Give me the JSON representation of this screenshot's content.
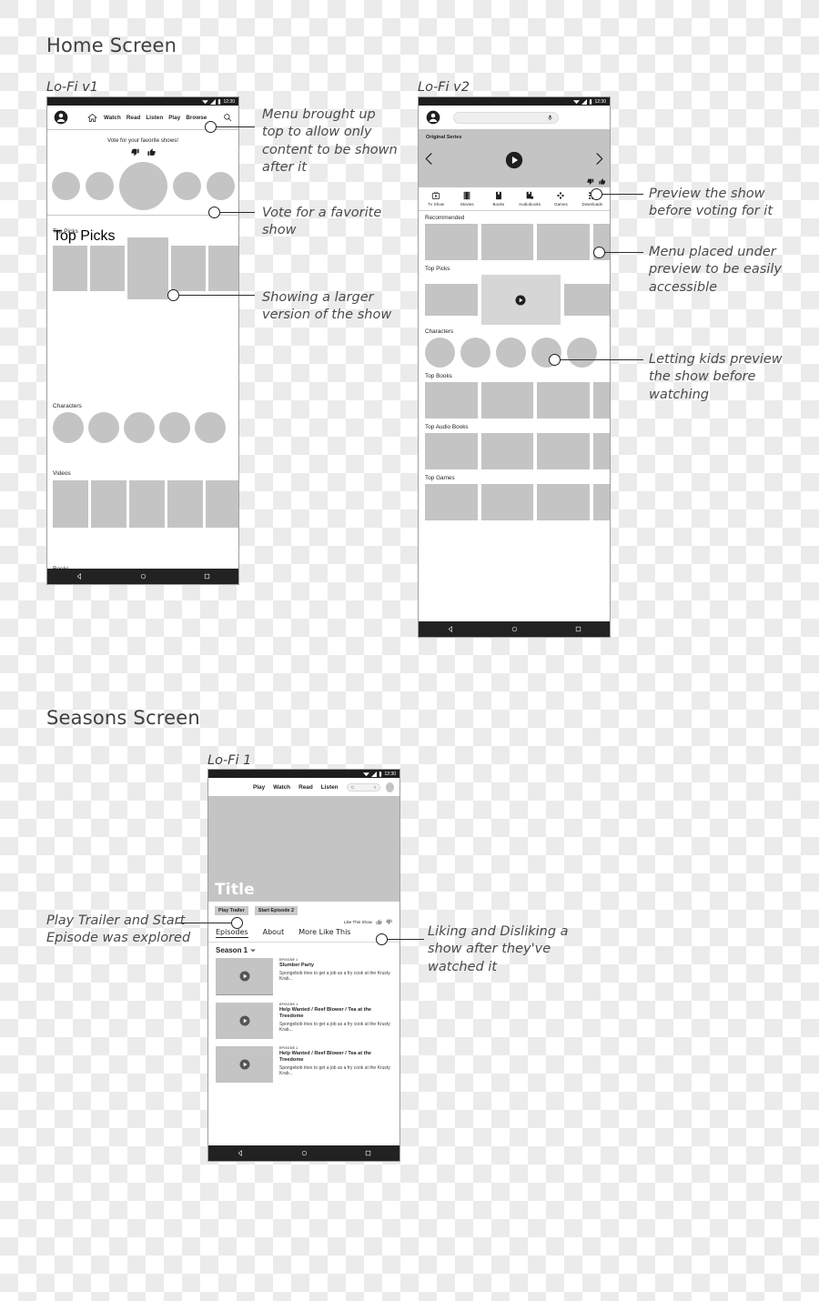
{
  "sections": {
    "home": {
      "title": "Home Screen",
      "v1_label": "Lo-Fi v1",
      "v2_label": "Lo-Fi v2"
    },
    "seasons": {
      "title": "Seasons Screen",
      "v1_label": "Lo-Fi 1"
    }
  },
  "annotations": {
    "home_v1": [
      "Menu brought up top to allow only content to be shown after it",
      "Vote for a favorite show",
      "Showing a larger version of the show"
    ],
    "home_v2": [
      "Preview the show before voting for it",
      "Menu placed under preview to be easily accessible",
      "Letting kids preview the show before watching"
    ],
    "seasons": [
      "Play Trailer and Start Episode was explored",
      "Liking and Disliking a show after they've watched it"
    ]
  },
  "phone1": {
    "status_time": "12:30",
    "nav_links": [
      "Watch",
      "Read",
      "Listen",
      "Play",
      "Browse"
    ],
    "home_icon": "home-icon",
    "avatar_icon": "account-circle-icon",
    "search_icon": "search-icon",
    "vote_prompt": "Vote for your favorite shows!",
    "thumb_down_icon": "thumb-down-icon",
    "thumb_up_icon": "thumb-up-icon",
    "rows": [
      {
        "title": "Top Picks",
        "kind": "cards-featured"
      },
      {
        "title": "Characters",
        "kind": "circles"
      },
      {
        "title": "Videos",
        "kind": "cards"
      },
      {
        "title": "Books",
        "kind": "cards-featured"
      }
    ],
    "bottom_nav": [
      "back-icon",
      "home-circle-icon",
      "recents-square-icon"
    ]
  },
  "phone2": {
    "status_time": "12:30",
    "avatar_icon": "account-circle-icon",
    "search_placeholder": "",
    "mic_icon": "microphone-icon",
    "hero_label": "Original Series",
    "prev_icon": "chevron-left-icon",
    "next_icon": "chevron-right-icon",
    "play_icon": "play-circle-icon",
    "thumb_down_icon": "thumb-down-icon",
    "thumb_up_icon": "thumb-up-icon",
    "categories": [
      {
        "label": "Tv Show",
        "icon": "tv-show-icon"
      },
      {
        "label": "Movies",
        "icon": "film-strip-icon"
      },
      {
        "label": "Books",
        "icon": "book-icon"
      },
      {
        "label": "Audiobooks",
        "icon": "audiobook-icon"
      },
      {
        "label": "Games",
        "icon": "gamepad-icon"
      },
      {
        "label": "Downloads",
        "icon": "apps-grid-icon"
      }
    ],
    "rows": [
      {
        "title": "Recommended",
        "kind": "wide-cards"
      },
      {
        "title": "Top Picks",
        "kind": "wide-cards-preview"
      },
      {
        "title": "Characters",
        "kind": "circles"
      },
      {
        "title": "Top Books",
        "kind": "wide-cards"
      },
      {
        "title": "Top Audio Books",
        "kind": "wide-cards"
      },
      {
        "title": "Top Games",
        "kind": "wide-cards"
      }
    ],
    "bottom_nav": [
      "back-icon",
      "home-circle-icon",
      "recents-square-icon"
    ]
  },
  "phone3": {
    "status_time": "12:30",
    "nav_links": [
      "Play",
      "Watch",
      "Read",
      "Listen"
    ],
    "search_icon": "search-icon",
    "mic_icon": "microphone-icon",
    "avatar_icon": "avatar-circle-icon",
    "hero_title": "Title",
    "buttons": [
      "Play Trailer",
      "Start Episode 2"
    ],
    "like_label": "Like This Show",
    "thumb_up_icon": "thumb-up-icon",
    "thumb_down_icon": "thumb-down-icon",
    "tabs": [
      "Episodes",
      "About",
      "More Like This"
    ],
    "active_tab": "Episodes",
    "season_selector": "Season 1",
    "season_caret_icon": "caret-down-icon",
    "episodes": [
      {
        "number": "EPISODE 1",
        "title": "Slumber Party",
        "desc": "Spongebob tries to get a job as a fry cook at the Krusty Krab...",
        "play_icon": "play-circle-icon"
      },
      {
        "number": "EPISODE 1",
        "title": "Help Wanted / Reef Blower / Tea at the Treedome",
        "desc": "Spongebob tries to get a job as a fry cook at the Krusty Krab...",
        "play_icon": "play-circle-icon"
      },
      {
        "number": "EPISODE 1",
        "title": "Help Wanted / Reef Blower / Tea at the Treedome",
        "desc": "Spongebob tries to get a job as a fry cook at the Krusty Krab...",
        "play_icon": "play-circle-icon"
      }
    ],
    "bottom_nav": [
      "back-icon",
      "home-circle-icon",
      "recents-square-icon"
    ]
  },
  "colors": {
    "placeholder_gray": "#c4c4c4",
    "status_bar": "#1e1e1e",
    "nav_bar": "#222222",
    "text": "#1f1f1f"
  }
}
